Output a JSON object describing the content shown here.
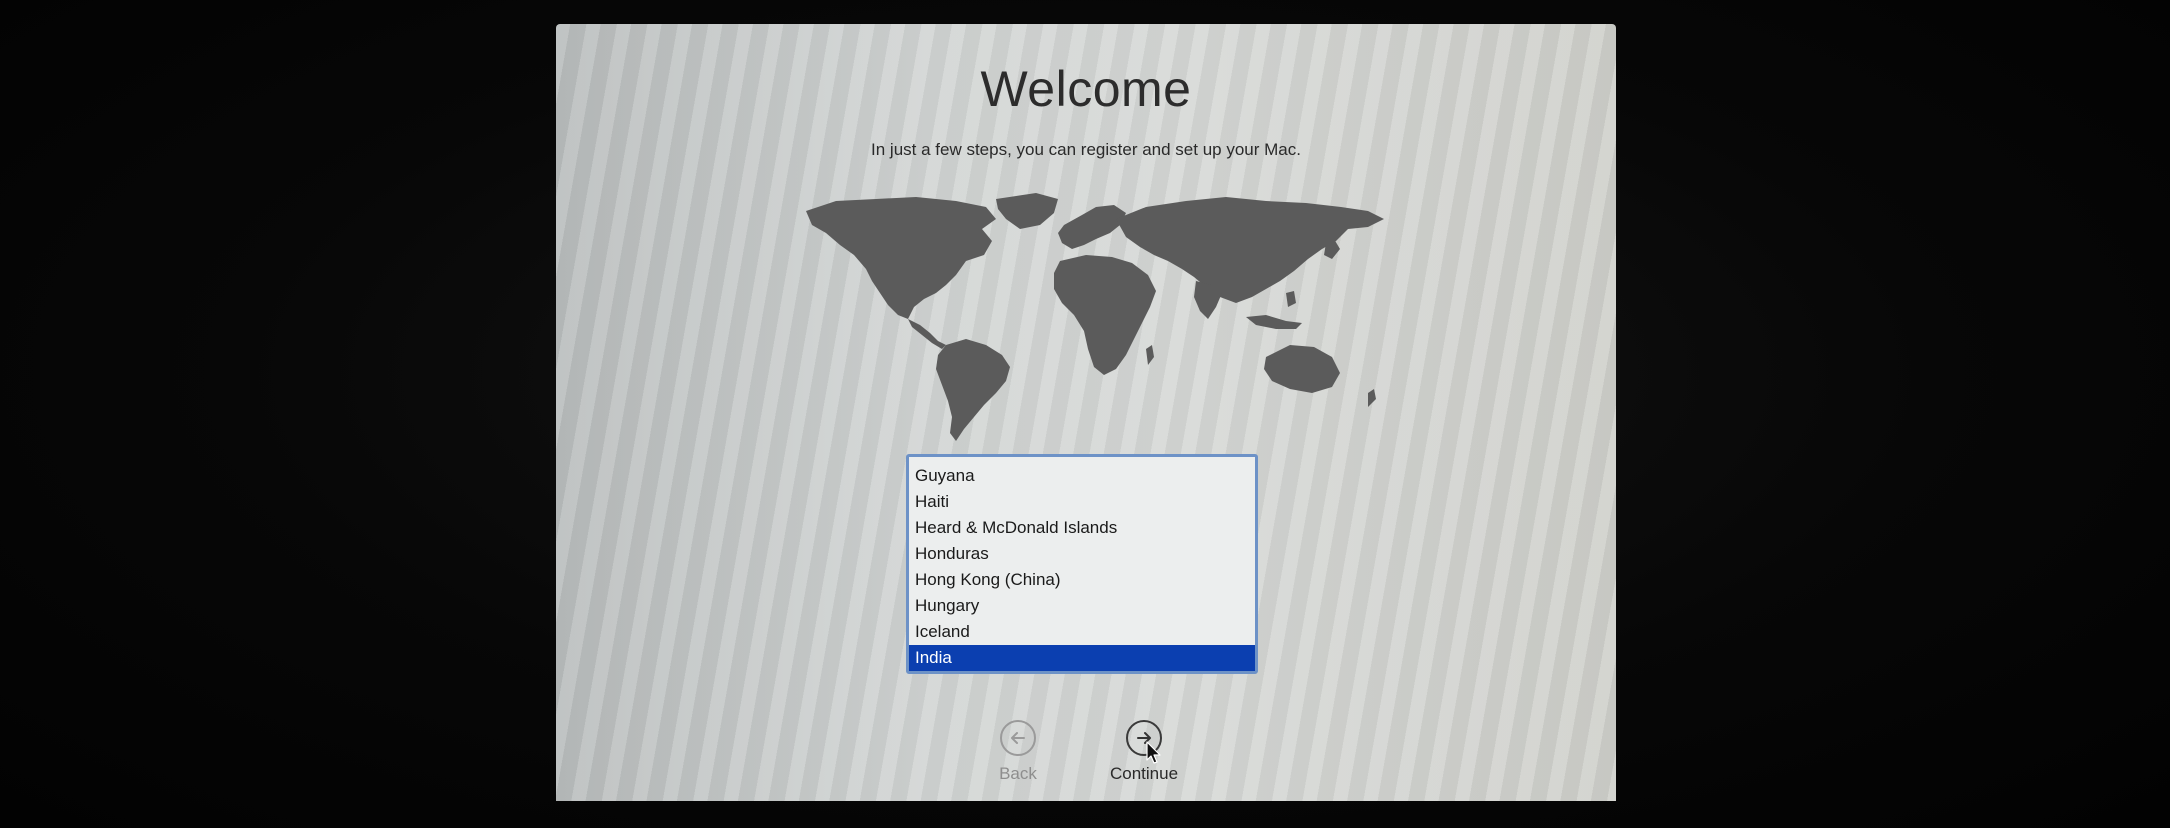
{
  "window": {
    "title": "Welcome",
    "subtitle": "In just a few steps, you can register and set up your Mac."
  },
  "map": {
    "icon": "world-map",
    "land_color": "#5a5a5a"
  },
  "country_list": {
    "items": [
      {
        "label": "Guyana",
        "selected": false
      },
      {
        "label": "Haiti",
        "selected": false
      },
      {
        "label": "Heard & McDonald Islands",
        "selected": false
      },
      {
        "label": "Honduras",
        "selected": false
      },
      {
        "label": "Hong Kong (China)",
        "selected": false
      },
      {
        "label": "Hungary",
        "selected": false
      },
      {
        "label": "Iceland",
        "selected": false
      },
      {
        "label": "India",
        "selected": true
      }
    ],
    "selected_color": "#0b3fb0"
  },
  "navigation": {
    "back_label": "Back",
    "back_icon": "arrow-left-circle-icon",
    "continue_label": "Continue",
    "continue_icon": "arrow-right-circle-icon"
  }
}
